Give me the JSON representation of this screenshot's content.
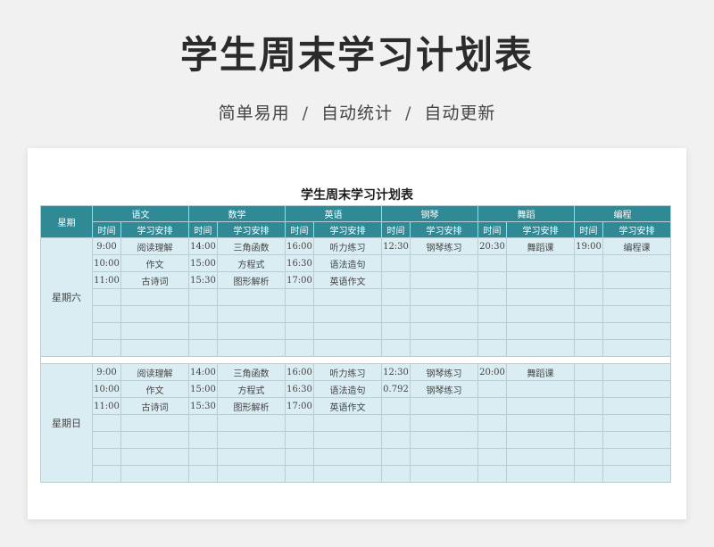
{
  "header": {
    "title": "学生周末学习计划表",
    "features": [
      "简单易用",
      "自动统计",
      "自动更新"
    ],
    "separator": "/"
  },
  "sheet": {
    "title": "学生周末学习计划表",
    "day_header": "星期",
    "time_header": "时间",
    "plan_header": "学习安排",
    "subjects": [
      "语文",
      "数学",
      "英语",
      "钢琴",
      "舞蹈",
      "编程"
    ],
    "blocks": [
      {
        "day": "星期六",
        "rows": [
          [
            "9:00",
            "阅读理解",
            "14:00",
            "三角函数",
            "16:00",
            "听力练习",
            "12:30",
            "钢琴练习",
            "20:30",
            "舞蹈课",
            "19:00",
            "编程课"
          ],
          [
            "10:00",
            "作文",
            "15:00",
            "方程式",
            "16:30",
            "语法造句",
            "",
            "",
            "",
            "",
            "",
            ""
          ],
          [
            "11:00",
            "古诗词",
            "15:30",
            "图形解析",
            "17:00",
            "英语作文",
            "",
            "",
            "",
            "",
            "",
            ""
          ],
          [
            "",
            "",
            "",
            "",
            "",
            "",
            "",
            "",
            "",
            "",
            "",
            ""
          ],
          [
            "",
            "",
            "",
            "",
            "",
            "",
            "",
            "",
            "",
            "",
            "",
            ""
          ],
          [
            "",
            "",
            "",
            "",
            "",
            "",
            "",
            "",
            "",
            "",
            "",
            ""
          ],
          [
            "",
            "",
            "",
            "",
            "",
            "",
            "",
            "",
            "",
            "",
            "",
            ""
          ]
        ]
      },
      {
        "day": "星期日",
        "rows": [
          [
            "9:00",
            "阅读理解",
            "14:00",
            "三角函数",
            "16:00",
            "听力练习",
            "12:30",
            "钢琴练习",
            "20:00",
            "舞蹈课",
            "",
            ""
          ],
          [
            "10:00",
            "作文",
            "15:00",
            "方程式",
            "16:30",
            "语法造句",
            "0.792",
            "钢琴练习",
            "",
            "",
            "",
            ""
          ],
          [
            "11:00",
            "古诗词",
            "15:30",
            "图形解析",
            "17:00",
            "英语作文",
            "",
            "",
            "",
            "",
            "",
            ""
          ],
          [
            "",
            "",
            "",
            "",
            "",
            "",
            "",
            "",
            "",
            "",
            "",
            ""
          ],
          [
            "",
            "",
            "",
            "",
            "",
            "",
            "",
            "",
            "",
            "",
            "",
            ""
          ],
          [
            "",
            "",
            "",
            "",
            "",
            "",
            "",
            "",
            "",
            "",
            "",
            ""
          ],
          [
            "",
            "",
            "",
            "",
            "",
            "",
            "",
            "",
            "",
            "",
            "",
            ""
          ]
        ]
      }
    ]
  }
}
